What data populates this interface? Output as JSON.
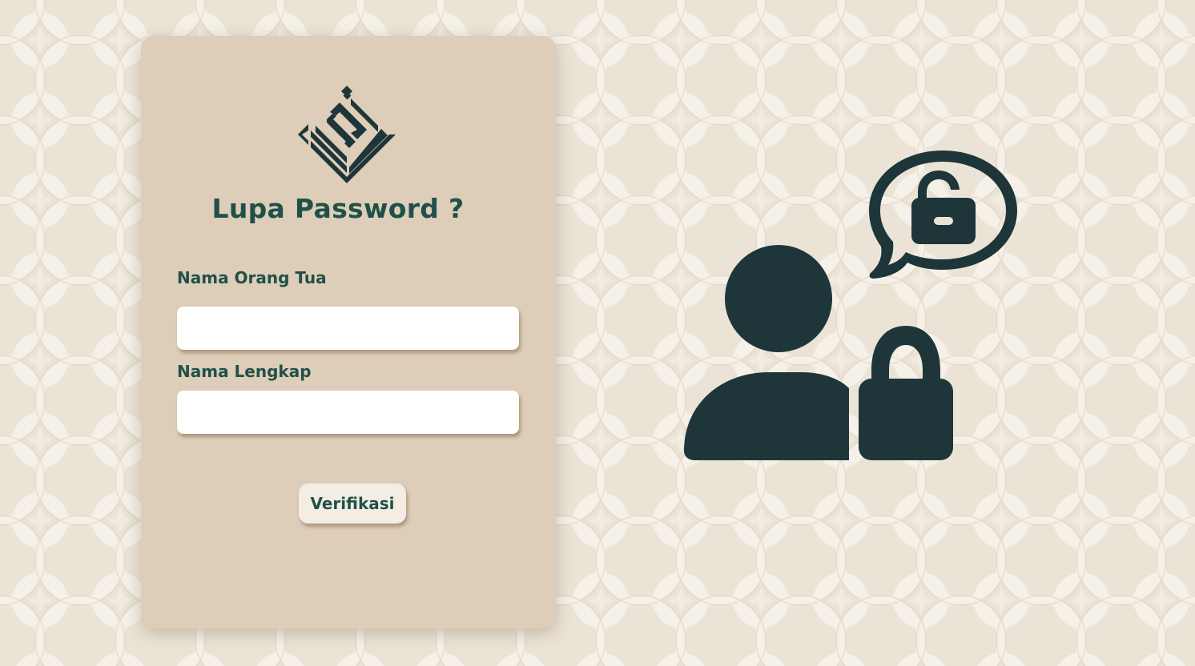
{
  "page": {
    "background_color": "#ebe4d6",
    "pattern_color": "#f6f2ea"
  },
  "card": {
    "background_color": "#decdb8",
    "logo_icon": "diamond-calligraphy-logo-icon",
    "title": "Lupa Password ?",
    "fields": {
      "parent_name": {
        "label": "Nama Orang Tua",
        "value": "",
        "placeholder": ""
      },
      "full_name": {
        "label": "Nama Lengkap",
        "value": "",
        "placeholder": ""
      }
    },
    "verify_button_label": "Verifikasi"
  },
  "illustration": {
    "icon": "user-locked-password-icon",
    "color": "#1e363a"
  },
  "colors": {
    "primary_text": "#1f5148",
    "icon_dark": "#1e363a",
    "input_bg": "#ffffff",
    "button_bg": "#f3ede4"
  }
}
